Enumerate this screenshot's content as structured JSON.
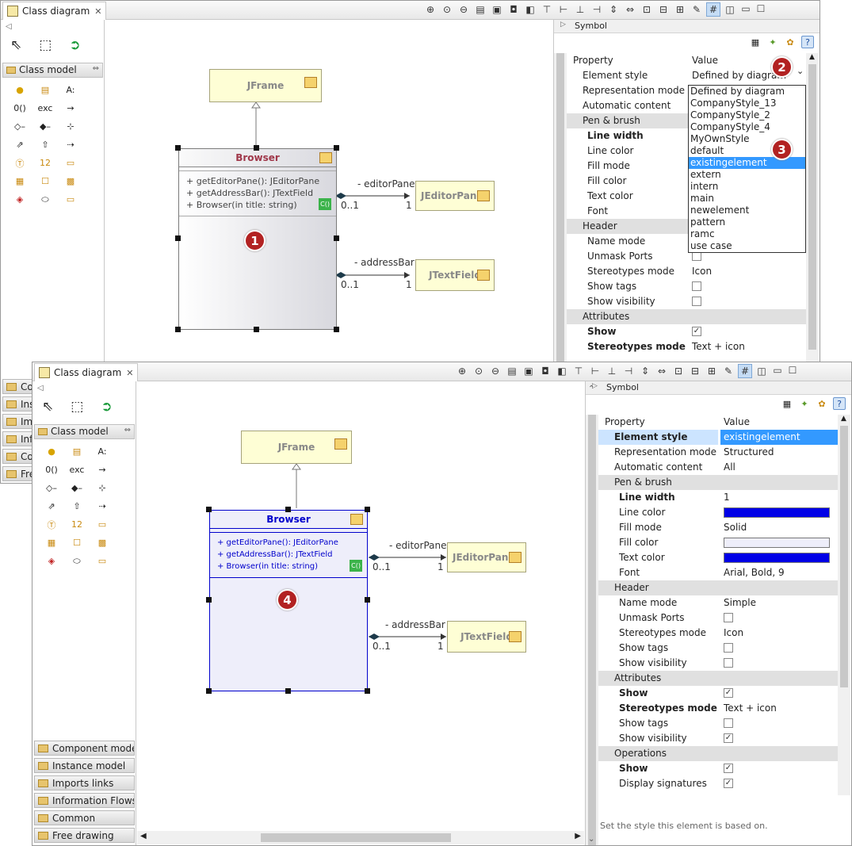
{
  "tab_title": "Class diagram",
  "palette": {
    "section_title": "Class model",
    "drawers_back": [
      "Co",
      "Inst",
      "Imp",
      "Info",
      "Co",
      "Free"
    ],
    "drawers": [
      "Component model",
      "Instance model",
      "Imports links",
      "Information Flows",
      "Common",
      "Free drawing"
    ]
  },
  "diagram": {
    "jframe": "JFrame",
    "browser": "Browser",
    "operations": [
      "+ getEditorPane(): JEditorPane",
      "+ getAddressBar(): JTextField",
      "+ Browser(in title: string)"
    ],
    "co_badge": "C()",
    "editor_role": "- editorPane",
    "editor_class": "JEditorPane",
    "address_role": "- addressBar",
    "address_class": "JTextField",
    "mult_source": "0..1",
    "mult_target": "1"
  },
  "badges": {
    "b1": "1",
    "b2": "2",
    "b3": "3",
    "b4": "4"
  },
  "symbol_title": "Symbol",
  "prop_header": {
    "property": "Property",
    "value": "Value"
  },
  "back_props": [
    {
      "name": "Element style",
      "value": "Defined by diagram",
      "level": 1,
      "type": "text"
    },
    {
      "name": "Representation mode",
      "value": "",
      "level": 1,
      "type": "text"
    },
    {
      "name": "Automatic content",
      "value": "",
      "level": 1,
      "type": "text"
    },
    {
      "name": "Pen & brush",
      "value": "",
      "level": 1,
      "type": "group"
    },
    {
      "name": "Line width",
      "value": "",
      "level": 2,
      "type": "text",
      "bold": true
    },
    {
      "name": "Line color",
      "value": "",
      "level": 2,
      "type": "text"
    },
    {
      "name": "Fill mode",
      "value": "",
      "level": 2,
      "type": "text"
    },
    {
      "name": "Fill color",
      "value": "",
      "level": 2,
      "type": "text"
    },
    {
      "name": "Text color",
      "value": "",
      "level": 2,
      "type": "text"
    },
    {
      "name": "Font",
      "value": "",
      "level": 2,
      "type": "text"
    },
    {
      "name": "Header",
      "value": "",
      "level": 1,
      "type": "group"
    },
    {
      "name": "Name mode",
      "value": "",
      "level": 2,
      "type": "text"
    },
    {
      "name": "Unmask Ports",
      "value": false,
      "level": 2,
      "type": "check"
    },
    {
      "name": "Stereotypes mode",
      "value": "Icon",
      "level": 2,
      "type": "text"
    },
    {
      "name": "Show tags",
      "value": false,
      "level": 2,
      "type": "check"
    },
    {
      "name": "Show visibility",
      "value": false,
      "level": 2,
      "type": "check"
    },
    {
      "name": "Attributes",
      "value": "",
      "level": 1,
      "type": "group"
    },
    {
      "name": "Show",
      "value": true,
      "level": 2,
      "type": "check",
      "bold": true
    },
    {
      "name": "Stereotypes mode",
      "value": "Text + icon",
      "level": 2,
      "type": "text",
      "bold": true
    }
  ],
  "style_options": [
    "Defined by diagram",
    "CompanyStyle_13",
    "CompanyStyle_2",
    "CompanyStyle_4",
    "MyOwnStyle",
    "default",
    "existingelement",
    "extern",
    "intern",
    "main",
    "newelement",
    "pattern",
    "ramc",
    "use case"
  ],
  "style_selected": "existingelement",
  "front_props": [
    {
      "name": "Element style",
      "value": "existingelement",
      "level": 1,
      "type": "text",
      "bold": true,
      "selected": true
    },
    {
      "name": "Representation mode",
      "value": "Structured",
      "level": 1,
      "type": "text"
    },
    {
      "name": "Automatic content",
      "value": "All",
      "level": 1,
      "type": "text"
    },
    {
      "name": "Pen & brush",
      "value": "",
      "level": 1,
      "type": "group"
    },
    {
      "name": "Line width",
      "value": "1",
      "level": 2,
      "type": "text",
      "bold": true
    },
    {
      "name": "Line color",
      "value": "#0000e6",
      "level": 2,
      "type": "color"
    },
    {
      "name": "Fill mode",
      "value": "Solid",
      "level": 2,
      "type": "text"
    },
    {
      "name": "Fill color",
      "value": "#eeeefa",
      "level": 2,
      "type": "color"
    },
    {
      "name": "Text color",
      "value": "#0000e6",
      "level": 2,
      "type": "color"
    },
    {
      "name": "Font",
      "value": "Arial, Bold, 9",
      "level": 2,
      "type": "text"
    },
    {
      "name": "Header",
      "value": "",
      "level": 1,
      "type": "group"
    },
    {
      "name": "Name mode",
      "value": "Simple",
      "level": 2,
      "type": "text"
    },
    {
      "name": "Unmask Ports",
      "value": false,
      "level": 2,
      "type": "check"
    },
    {
      "name": "Stereotypes mode",
      "value": "Icon",
      "level": 2,
      "type": "text"
    },
    {
      "name": "Show tags",
      "value": false,
      "level": 2,
      "type": "check"
    },
    {
      "name": "Show visibility",
      "value": false,
      "level": 2,
      "type": "check"
    },
    {
      "name": "Attributes",
      "value": "",
      "level": 1,
      "type": "group"
    },
    {
      "name": "Show",
      "value": true,
      "level": 2,
      "type": "check",
      "bold": true
    },
    {
      "name": "Stereotypes mode",
      "value": "Text + icon",
      "level": 2,
      "type": "text",
      "bold": true
    },
    {
      "name": "Show tags",
      "value": false,
      "level": 2,
      "type": "check"
    },
    {
      "name": "Show visibility",
      "value": true,
      "level": 2,
      "type": "check"
    },
    {
      "name": "Operations",
      "value": "",
      "level": 1,
      "type": "group"
    },
    {
      "name": "Show",
      "value": true,
      "level": 2,
      "type": "check",
      "bold": true
    },
    {
      "name": "Display signatures",
      "value": true,
      "level": 2,
      "type": "check"
    }
  ],
  "hint": "Set the style this element is based on.",
  "colors": {
    "selected_blue": "#0000cc",
    "badge": "#b22222",
    "selection": "#3399ff"
  }
}
